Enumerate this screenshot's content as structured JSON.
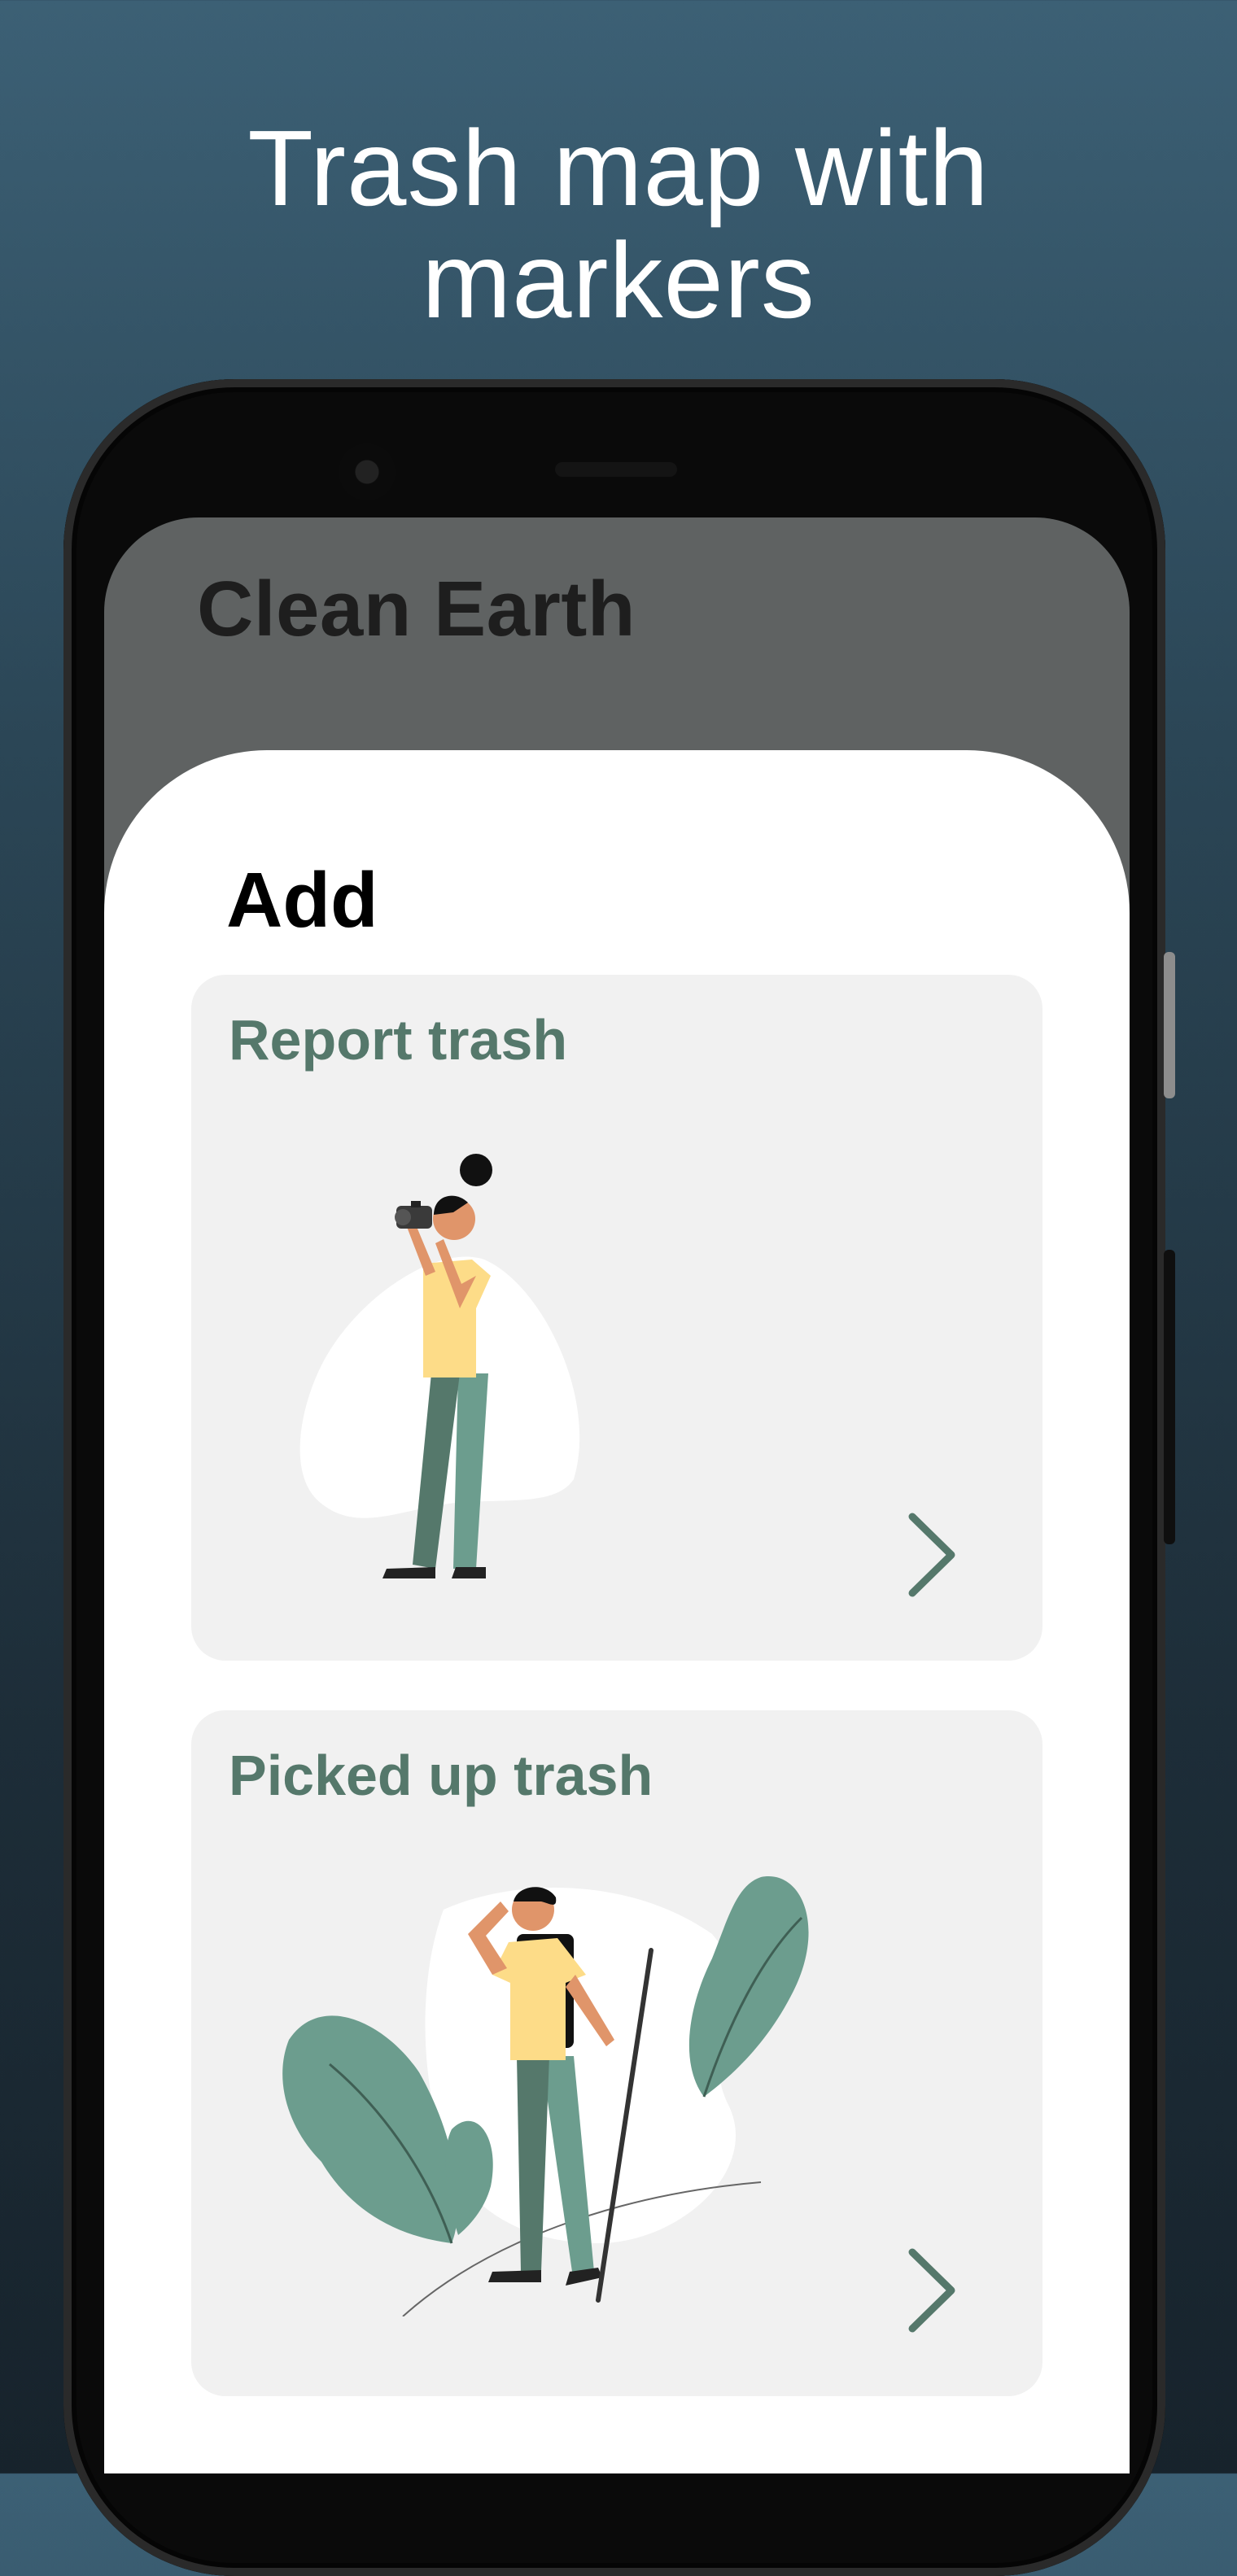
{
  "promo": {
    "title_line1": "Trash map with",
    "title_line2": "markers"
  },
  "app": {
    "title": "Clean Earth"
  },
  "sheet": {
    "heading": "Add",
    "cards": [
      {
        "title": "Report trash",
        "illustration": "person-with-camera"
      },
      {
        "title": "Picked up trash",
        "illustration": "person-with-trash-picker"
      }
    ]
  },
  "colors": {
    "accent_green": "#55786b",
    "card_bg": "#f1f1f1",
    "header_bg": "#5f6262",
    "background_top": "#3c6075",
    "background_bottom": "#17232c"
  },
  "icons": {
    "card_arrow": "chevron-right-icon"
  }
}
